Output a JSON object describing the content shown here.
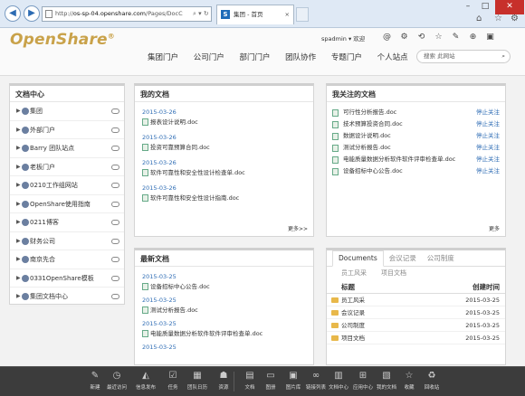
{
  "browser": {
    "url_prefix": "http://",
    "url_host": "os-sp-04.openshare.com",
    "url_path": "/Pages/DocC",
    "tab_title": "集团 - 首页",
    "tab_logo_letter": "S",
    "icons": {
      "back": "back-arrow-icon",
      "forward": "forward-arrow-icon"
    }
  },
  "header": {
    "logo_text": "OpenShare",
    "logo_mark": "®",
    "user": "spadmin ▾",
    "welcome": "欢迎",
    "nav": [
      "集团门户",
      "公司门户",
      "部门门户",
      "团队协作",
      "专题门户",
      "个人站点"
    ],
    "search_placeholder": "搜索 此网站"
  },
  "left_panel": {
    "title": "文档中心",
    "items": [
      "集团",
      "外部门户",
      "Barry 团队站点",
      "老板门户",
      "0210工作组网站",
      "OpenShare使用指南",
      "0211博客",
      "财务公司",
      "南京先合",
      "0331OpenShare模板",
      "集团文档中心"
    ]
  },
  "my_docs": {
    "title": "我的文档",
    "entries": [
      {
        "date": "2015-03-26",
        "title": "报表设计说明.doc"
      },
      {
        "date": "2015-03-26",
        "title": "投资可靠预算合同.doc"
      },
      {
        "date": "2015-03-26",
        "title": "软件可靠性和安全性设计检查单.doc"
      },
      {
        "date": "2015-03-26",
        "title": "软件可靠性和安全性设计指南.doc"
      }
    ],
    "more": "更多>>"
  },
  "followed_docs": {
    "title": "我关注的文档",
    "unfollow_label": "停止关注",
    "rows": [
      "可行性分析报告.doc",
      "技术预算投资合同.doc",
      "数据设计说明.doc",
      "测试分析报告.doc",
      "电能质量数据分析软件软件评审检查单.doc",
      "设备招标中心公告.doc"
    ],
    "more": "更多"
  },
  "new_docs": {
    "title": "最新文档",
    "entries": [
      {
        "date": "2015-03-25",
        "title": "设备招标中心公告.doc"
      },
      {
        "date": "2015-03-25",
        "title": "测试分析报告.doc"
      },
      {
        "date": "2015-03-25",
        "title": "电能质量数据分析软件软件评审检查单.doc"
      },
      {
        "date": "2015-03-25",
        "title": ""
      }
    ]
  },
  "doc_tabs": {
    "tabs": [
      "Documents",
      "会议记录",
      "公司制度"
    ],
    "sub_tabs": [
      "员工风采",
      "项目文档"
    ],
    "col_name": "标题",
    "col_created": "创建时间",
    "rows": [
      {
        "name": "员工风采",
        "created": "2015-03-25"
      },
      {
        "name": "会议记录",
        "created": "2015-03-25"
      },
      {
        "name": "公司制度",
        "created": "2015-03-25"
      },
      {
        "name": "项目文档",
        "created": "2015-03-25"
      }
    ]
  },
  "dock": {
    "items": [
      "新建",
      "最近访问",
      "信息发布",
      "任务",
      "团队日历",
      "资源",
      "文档",
      "图册",
      "图片库",
      "链接列表",
      "文档中心",
      "应用中心",
      "我的文档",
      "收藏",
      "回收站"
    ]
  }
}
